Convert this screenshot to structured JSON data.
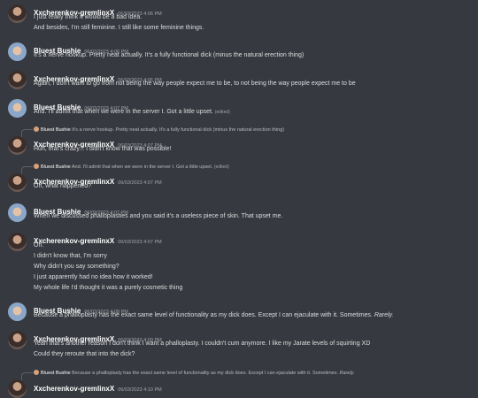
{
  "users": {
    "x": "Xxcherenkov-gremlinxX",
    "b": "Bluest Bushie"
  },
  "messages": [
    {
      "user": "Xxcherenkov-gremlinxX",
      "time": "06/03/2023 4:06 PM",
      "lines": [
        "I just really think it would be a bad idea.",
        "And besides, I'm still feminine. I still like some feminine things."
      ]
    },
    {
      "user": "Bluest Bushie",
      "time": "06/03/2023 4:06 PM",
      "lines": [
        "It's a nerve hookup. Pretty neat actually. It's a fully functional dick (minus the natural erection thing)"
      ]
    },
    {
      "user": "Xxcherenkov-gremlinxX",
      "time": "06/03/2023 4:06 PM",
      "lines": [
        "Again, I don't want to go from not being the way people expect me to be, to not being the way people expect me to be"
      ]
    },
    {
      "user": "Bluest Bushie",
      "time": "06/03/2023 4:07 PM",
      "lines": [
        "And. I'll admit that when we were in the server I. Got a little upset."
      ],
      "edited": "(edited)"
    },
    {
      "user": "Xxcherenkov-gremlinxX",
      "time": "06/03/2023 4:07 PM",
      "reply": {
        "name": "Bluest Bushie",
        "text": "It's a nerve hookup. Pretty neat actually. It's a fully functional dick (minus the natural erection thing)"
      },
      "lines": [
        "Huh, that's crazy... I didn't know that was possible!"
      ]
    },
    {
      "user": "Xxcherenkov-gremlinxX",
      "time": "06/03/2023 4:07 PM",
      "reply": {
        "name": "Bluest Bushie",
        "text": "And. I'll admit that when we were in the server I. Got a little upset.",
        "edited": "(edited)"
      },
      "lines": [
        "Oh, what happened?"
      ]
    },
    {
      "user": "Bluest Bushie",
      "time": "06/03/2023 4:07 PM",
      "lines": [
        "When we discussed phalloplasties and you said it's a useless piece of skin. That upset me."
      ]
    },
    {
      "user": "Xxcherenkov-gremlinxX",
      "time": "06/03/2023 4:07 PM",
      "lines": [
        "Oh.",
        "I didn't know that, I'm sorry",
        "Why didn't you say something?",
        "I just apparently had no idea how it worked!",
        "My whole life I'd thought it was a purely cosmetic thing"
      ]
    },
    {
      "user": "Bluest Bushie",
      "time": "06/03/2023 4:08 PM",
      "lines": [
        "Because a phalloplasty has the exact same level of functionality as my dick does. Except I can ejaculate with it. Sometimes."
      ],
      "emphasis": "Rarely."
    },
    {
      "user": "Xxcherenkov-gremlinxX",
      "time": "06/03/2023 4:09 PM",
      "lines": [
        "Yeah that's another reason I don't think I want a phalloplasty. I couldn't cum anymore. I like my Jarate levels of squirting XD",
        "Could they reroute that into the dick?"
      ]
    },
    {
      "user": "Xxcherenkov-gremlinxX",
      "time": "06/03/2023 4:10 PM",
      "reply": {
        "name": "Bluest Bushie",
        "text": "Because a phalloplasty has the exact same level of functionality as my dick does. Except I can ejaculate with it. Sometimes.",
        "emphasis": "Rarely."
      },
      "lines": []
    }
  ]
}
